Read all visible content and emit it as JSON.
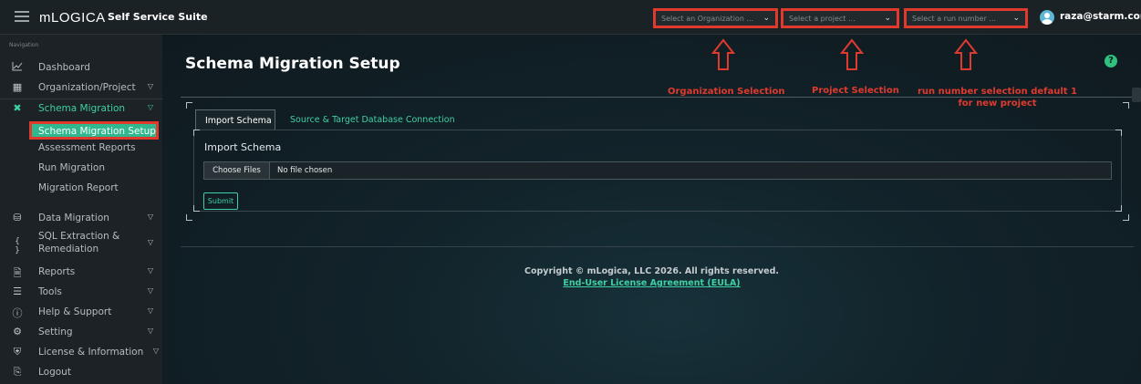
{
  "app": {
    "brand": "mLOGICA",
    "suite": "Self Service Suite"
  },
  "header": {
    "org_select": "Select an Organization ...",
    "project_select": "Select a project ...",
    "run_select": "Select a run number ...",
    "user": "raza@starm.com"
  },
  "sidebar": {
    "caption": "Navigation",
    "items": [
      {
        "label": "Dashboard",
        "icon": "chart-line-icon"
      },
      {
        "label": "Organization/Project",
        "icon": "grid-icon"
      },
      {
        "label": "Schema Migration",
        "icon": "tools-icon"
      },
      {
        "label": "Data Migration",
        "icon": "database-icon"
      },
      {
        "label": "SQL Extraction & Remediation",
        "icon": "code-braces-icon"
      },
      {
        "label": "Reports",
        "icon": "document-icon"
      },
      {
        "label": "Tools",
        "icon": "layers-icon"
      },
      {
        "label": "Help & Support",
        "icon": "help-circle-icon"
      },
      {
        "label": "Setting",
        "icon": "gear-icon"
      },
      {
        "label": "License & Information",
        "icon": "shield-icon"
      },
      {
        "label": "Logout",
        "icon": "logout-icon"
      }
    ],
    "schema_sub": [
      "Schema Migration Setup",
      "Assessment Reports",
      "Run Migration",
      "Migration Report"
    ]
  },
  "main": {
    "title": "Schema Migration Setup",
    "annotations": {
      "org": "Organization Selection",
      "project": "Project Selection",
      "run": "run number selection default 1\nfor new project"
    },
    "tabs": [
      "Import Schema",
      "Source & Target Database Connection"
    ],
    "section_title": "Import Schema",
    "file_button": "Choose Files",
    "file_status": "No file chosen",
    "submit": "Submit"
  },
  "footer": {
    "copyright": "Copyright © mLogica, LLC 2026. All rights reserved.",
    "eula": "End-User License Agreement (EULA)"
  },
  "colors": {
    "accent": "#3ed0a2",
    "annotation": "#e03a2f",
    "help": "#2ec27e"
  }
}
